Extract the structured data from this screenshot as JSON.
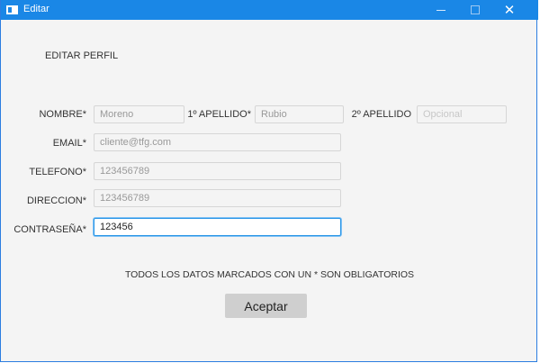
{
  "window": {
    "title": "Editar"
  },
  "heading": "EDITAR PERFIL",
  "form": {
    "nombre": {
      "label": "NOMBRE*",
      "value": "Moreno"
    },
    "apellido1": {
      "label": "1º APELLIDO*",
      "value": "Rubio"
    },
    "apellido2": {
      "label": "2º APELLIDO",
      "placeholder": "Opcional"
    },
    "email": {
      "label": "EMAIL*",
      "value": "cliente@tfg.com"
    },
    "telefono": {
      "label": "TELEFONO*",
      "value": "123456789"
    },
    "direccion": {
      "label": "DIRECCION*",
      "value": "123456789"
    },
    "contrasena": {
      "label": "CONTRASEÑA*",
      "value": "123456"
    }
  },
  "note": "TODOS LOS DATOS MARCADOS CON UN * SON OBLIGATORIOS",
  "accept_label": "Aceptar",
  "colors": {
    "titlebar": "#1a87e6",
    "focus": "#2b96e6"
  }
}
